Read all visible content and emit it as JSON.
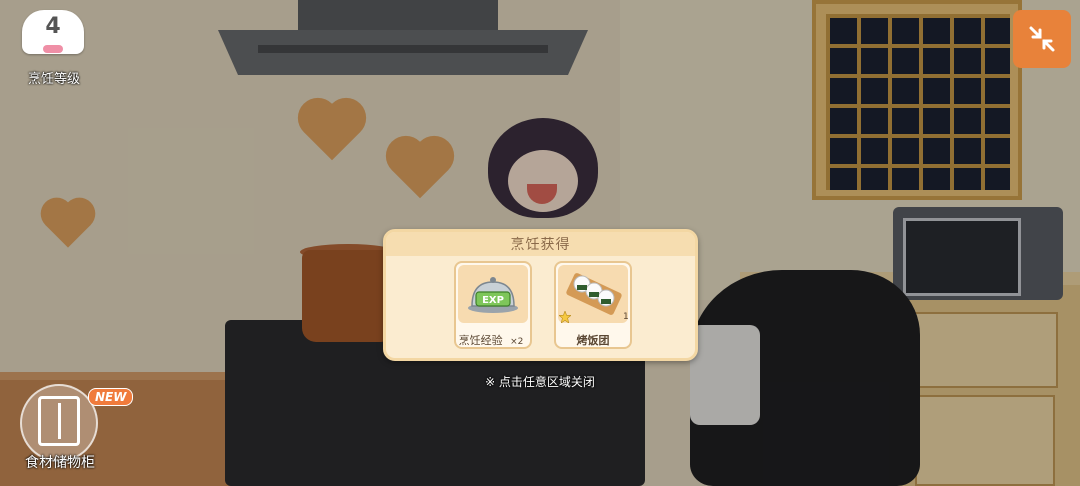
{
  "hud": {
    "cooking_level": {
      "value": "4",
      "label": "烹饪等级",
      "icon": "chef-hat-icon"
    },
    "expand_button": {
      "icon": "collapse-arrows-icon"
    },
    "storage": {
      "label": "食材储物柜",
      "badge": "NEW",
      "icon": "cabinet-icon"
    }
  },
  "dialog": {
    "title": "烹饪获得",
    "items": [
      {
        "label": "烹饪经验",
        "qty": "×2",
        "icon": "exp-cloche-icon"
      },
      {
        "label": "烤饭团",
        "qty": "1",
        "icon": "grilled-rice-ball-icon",
        "star_icon": "star-icon"
      }
    ],
    "close_hint": "※ 点击任意区域关闭"
  },
  "colors": {
    "accent_orange": "#e8823a",
    "dialog_bg": "#fbecd0",
    "dialog_border": "#f3d7a3",
    "new_badge": "#f07b3c"
  }
}
